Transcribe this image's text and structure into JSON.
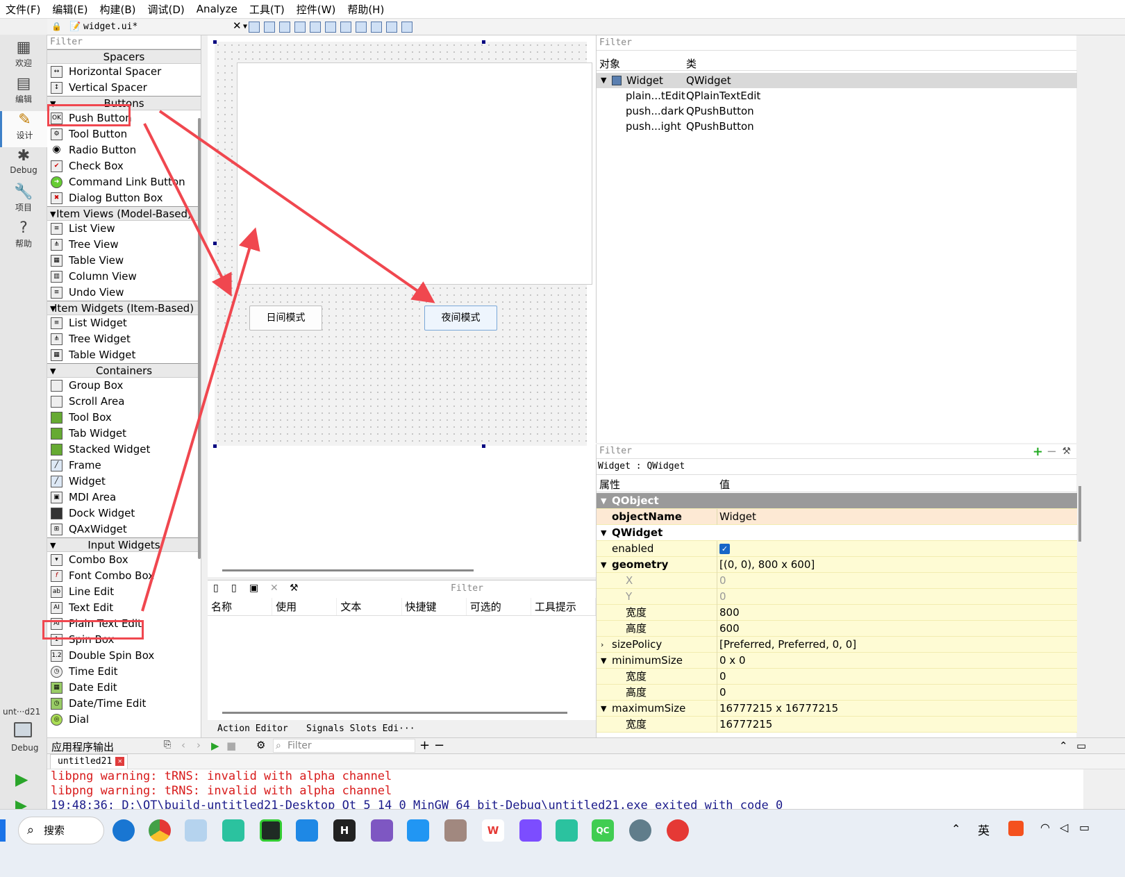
{
  "menu": [
    "文件(F)",
    "编辑(E)",
    "构建(B)",
    "调试(D)",
    "Analyze",
    "工具(T)",
    "控件(W)",
    "帮助(H)"
  ],
  "sidebar": {
    "items": [
      {
        "label": "欢迎",
        "icon": "grid-icon"
      },
      {
        "label": "编辑",
        "icon": "edit-doc-icon"
      },
      {
        "label": "设计",
        "icon": "pencil-icon"
      },
      {
        "label": "Debug",
        "icon": "bug-icon"
      },
      {
        "label": "项目",
        "icon": "wrench-icon"
      },
      {
        "label": "帮助",
        "icon": "help-icon"
      }
    ],
    "kit_label": "unt···d21",
    "kit_debug": "Debug"
  },
  "toolbar": {
    "file": "widget.ui*"
  },
  "widgetbox": {
    "filter": "Filter",
    "cat_spacers": "Spacers",
    "spacers": [
      "Horizontal Spacer",
      "Vertical Spacer"
    ],
    "cat_buttons": "Buttons",
    "buttons": [
      "Push Button",
      "Tool Button",
      "Radio Button",
      "Check Box",
      "Command Link Button",
      "Dialog Button Box"
    ],
    "cat_itemviews": "Item Views (Model-Based)",
    "itemviews": [
      "List View",
      "Tree View",
      "Table View",
      "Column View",
      "Undo View"
    ],
    "cat_itemwidgets": "Item Widgets (Item-Based)",
    "itemwidgets": [
      "List Widget",
      "Tree Widget",
      "Table Widget"
    ],
    "cat_containers": "Containers",
    "containers": [
      "Group Box",
      "Scroll Area",
      "Tool Box",
      "Tab Widget",
      "Stacked Widget",
      "Frame",
      "Widget",
      "MDI Area",
      "Dock Widget",
      "QAxWidget"
    ],
    "cat_input": "Input Widgets",
    "input": [
      "Combo Box",
      "Font Combo Box",
      "Line Edit",
      "Text Edit",
      "Plain Text Edit",
      "Spin Box",
      "Double Spin Box",
      "Time Edit",
      "Date Edit",
      "Date/Time Edit",
      "Dial"
    ]
  },
  "form": {
    "day_button": "日间模式",
    "night_button": "夜间模式"
  },
  "action_editor": {
    "filter": "Filter",
    "columns": [
      "名称",
      "使用",
      "文本",
      "快捷键",
      "可选的",
      "工具提示"
    ],
    "tab_action": "Action Editor",
    "tab_signals": "Signals  Slots Edi···"
  },
  "object_inspector": {
    "filter": "Filter",
    "col_object": "对象",
    "col_class": "类",
    "rows": [
      {
        "name": "Widget",
        "cls": "QWidget"
      },
      {
        "name": "plain...tEdit",
        "cls": "QPlainTextEdit"
      },
      {
        "name": "push...dark",
        "cls": "QPushButton"
      },
      {
        "name": "push...ight",
        "cls": "QPushButton"
      }
    ]
  },
  "property_editor": {
    "filter": "Filter",
    "title": "Widget : QWidget",
    "col_prop": "属性",
    "col_value": "值",
    "rows": [
      {
        "n": "QObject",
        "v": ""
      },
      {
        "n": "objectName",
        "v": "Widget"
      },
      {
        "n": "QWidget",
        "v": ""
      },
      {
        "n": "enabled",
        "v": ""
      },
      {
        "n": "geometry",
        "v": "[(0, 0), 800 x 600]"
      },
      {
        "n": "X",
        "v": "0"
      },
      {
        "n": "Y",
        "v": "0"
      },
      {
        "n": "宽度",
        "v": "800"
      },
      {
        "n": "高度",
        "v": "600"
      },
      {
        "n": "sizePolicy",
        "v": "[Preferred, Preferred, 0, 0]"
      },
      {
        "n": "minimumSize",
        "v": "0 x 0"
      },
      {
        "n": "宽度",
        "v": "0"
      },
      {
        "n": "高度",
        "v": "0"
      },
      {
        "n": "maximumSize",
        "v": "16777215 x 16777215"
      },
      {
        "n": "宽度",
        "v": "16777215"
      }
    ]
  },
  "output": {
    "title": "应用程序输出",
    "filter": "Filter",
    "tab": "untitled21",
    "lines": [
      "libpng warning: tRNS: invalid with alpha channel",
      "libpng warning: tRNS: invalid with alpha channel",
      "19:48:36: D:\\QT\\build-untitled21-Desktop_Qt_5_14_0_MinGW_64_bit-Debug\\untitled21.exe exited with code 0"
    ]
  },
  "taskbar": {
    "search": "搜索",
    "ime": "英"
  },
  "colors": {
    "annotation": "#f0474f",
    "accent": "#3d80c8",
    "prop_bg": "#fefbd4"
  }
}
